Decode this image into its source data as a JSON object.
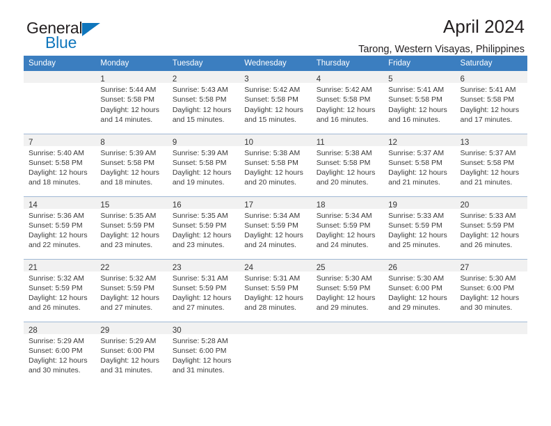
{
  "brand": {
    "name_top": "General",
    "name_bottom": "Blue",
    "accent_color": "#0f76bc",
    "logo_icon": "triangle-icon"
  },
  "header": {
    "title": "April 2024",
    "subtitle": "Tarong, Western Visayas, Philippines"
  },
  "calendar": {
    "header_bg_color": "#3b7ec0",
    "header_text_color": "#ffffff",
    "daynum_band_color": "#f1f1f1",
    "grid_line_color": "#9fb8d4",
    "weekday_headers": [
      "Sunday",
      "Monday",
      "Tuesday",
      "Wednesday",
      "Thursday",
      "Friday",
      "Saturday"
    ],
    "weeks": [
      [
        {
          "day": "",
          "sunrise": "",
          "sunset": "",
          "daylight_line1": "",
          "daylight_line2": ""
        },
        {
          "day": "1",
          "sunrise": "Sunrise: 5:44 AM",
          "sunset": "Sunset: 5:58 PM",
          "daylight_line1": "Daylight: 12 hours",
          "daylight_line2": "and 14 minutes."
        },
        {
          "day": "2",
          "sunrise": "Sunrise: 5:43 AM",
          "sunset": "Sunset: 5:58 PM",
          "daylight_line1": "Daylight: 12 hours",
          "daylight_line2": "and 15 minutes."
        },
        {
          "day": "3",
          "sunrise": "Sunrise: 5:42 AM",
          "sunset": "Sunset: 5:58 PM",
          "daylight_line1": "Daylight: 12 hours",
          "daylight_line2": "and 15 minutes."
        },
        {
          "day": "4",
          "sunrise": "Sunrise: 5:42 AM",
          "sunset": "Sunset: 5:58 PM",
          "daylight_line1": "Daylight: 12 hours",
          "daylight_line2": "and 16 minutes."
        },
        {
          "day": "5",
          "sunrise": "Sunrise: 5:41 AM",
          "sunset": "Sunset: 5:58 PM",
          "daylight_line1": "Daylight: 12 hours",
          "daylight_line2": "and 16 minutes."
        },
        {
          "day": "6",
          "sunrise": "Sunrise: 5:41 AM",
          "sunset": "Sunset: 5:58 PM",
          "daylight_line1": "Daylight: 12 hours",
          "daylight_line2": "and 17 minutes."
        }
      ],
      [
        {
          "day": "7",
          "sunrise": "Sunrise: 5:40 AM",
          "sunset": "Sunset: 5:58 PM",
          "daylight_line1": "Daylight: 12 hours",
          "daylight_line2": "and 18 minutes."
        },
        {
          "day": "8",
          "sunrise": "Sunrise: 5:39 AM",
          "sunset": "Sunset: 5:58 PM",
          "daylight_line1": "Daylight: 12 hours",
          "daylight_line2": "and 18 minutes."
        },
        {
          "day": "9",
          "sunrise": "Sunrise: 5:39 AM",
          "sunset": "Sunset: 5:58 PM",
          "daylight_line1": "Daylight: 12 hours",
          "daylight_line2": "and 19 minutes."
        },
        {
          "day": "10",
          "sunrise": "Sunrise: 5:38 AM",
          "sunset": "Sunset: 5:58 PM",
          "daylight_line1": "Daylight: 12 hours",
          "daylight_line2": "and 20 minutes."
        },
        {
          "day": "11",
          "sunrise": "Sunrise: 5:38 AM",
          "sunset": "Sunset: 5:58 PM",
          "daylight_line1": "Daylight: 12 hours",
          "daylight_line2": "and 20 minutes."
        },
        {
          "day": "12",
          "sunrise": "Sunrise: 5:37 AM",
          "sunset": "Sunset: 5:58 PM",
          "daylight_line1": "Daylight: 12 hours",
          "daylight_line2": "and 21 minutes."
        },
        {
          "day": "13",
          "sunrise": "Sunrise: 5:37 AM",
          "sunset": "Sunset: 5:58 PM",
          "daylight_line1": "Daylight: 12 hours",
          "daylight_line2": "and 21 minutes."
        }
      ],
      [
        {
          "day": "14",
          "sunrise": "Sunrise: 5:36 AM",
          "sunset": "Sunset: 5:59 PM",
          "daylight_line1": "Daylight: 12 hours",
          "daylight_line2": "and 22 minutes."
        },
        {
          "day": "15",
          "sunrise": "Sunrise: 5:35 AM",
          "sunset": "Sunset: 5:59 PM",
          "daylight_line1": "Daylight: 12 hours",
          "daylight_line2": "and 23 minutes."
        },
        {
          "day": "16",
          "sunrise": "Sunrise: 5:35 AM",
          "sunset": "Sunset: 5:59 PM",
          "daylight_line1": "Daylight: 12 hours",
          "daylight_line2": "and 23 minutes."
        },
        {
          "day": "17",
          "sunrise": "Sunrise: 5:34 AM",
          "sunset": "Sunset: 5:59 PM",
          "daylight_line1": "Daylight: 12 hours",
          "daylight_line2": "and 24 minutes."
        },
        {
          "day": "18",
          "sunrise": "Sunrise: 5:34 AM",
          "sunset": "Sunset: 5:59 PM",
          "daylight_line1": "Daylight: 12 hours",
          "daylight_line2": "and 24 minutes."
        },
        {
          "day": "19",
          "sunrise": "Sunrise: 5:33 AM",
          "sunset": "Sunset: 5:59 PM",
          "daylight_line1": "Daylight: 12 hours",
          "daylight_line2": "and 25 minutes."
        },
        {
          "day": "20",
          "sunrise": "Sunrise: 5:33 AM",
          "sunset": "Sunset: 5:59 PM",
          "daylight_line1": "Daylight: 12 hours",
          "daylight_line2": "and 26 minutes."
        }
      ],
      [
        {
          "day": "21",
          "sunrise": "Sunrise: 5:32 AM",
          "sunset": "Sunset: 5:59 PM",
          "daylight_line1": "Daylight: 12 hours",
          "daylight_line2": "and 26 minutes."
        },
        {
          "day": "22",
          "sunrise": "Sunrise: 5:32 AM",
          "sunset": "Sunset: 5:59 PM",
          "daylight_line1": "Daylight: 12 hours",
          "daylight_line2": "and 27 minutes."
        },
        {
          "day": "23",
          "sunrise": "Sunrise: 5:31 AM",
          "sunset": "Sunset: 5:59 PM",
          "daylight_line1": "Daylight: 12 hours",
          "daylight_line2": "and 27 minutes."
        },
        {
          "day": "24",
          "sunrise": "Sunrise: 5:31 AM",
          "sunset": "Sunset: 5:59 PM",
          "daylight_line1": "Daylight: 12 hours",
          "daylight_line2": "and 28 minutes."
        },
        {
          "day": "25",
          "sunrise": "Sunrise: 5:30 AM",
          "sunset": "Sunset: 5:59 PM",
          "daylight_line1": "Daylight: 12 hours",
          "daylight_line2": "and 29 minutes."
        },
        {
          "day": "26",
          "sunrise": "Sunrise: 5:30 AM",
          "sunset": "Sunset: 6:00 PM",
          "daylight_line1": "Daylight: 12 hours",
          "daylight_line2": "and 29 minutes."
        },
        {
          "day": "27",
          "sunrise": "Sunrise: 5:30 AM",
          "sunset": "Sunset: 6:00 PM",
          "daylight_line1": "Daylight: 12 hours",
          "daylight_line2": "and 30 minutes."
        }
      ],
      [
        {
          "day": "28",
          "sunrise": "Sunrise: 5:29 AM",
          "sunset": "Sunset: 6:00 PM",
          "daylight_line1": "Daylight: 12 hours",
          "daylight_line2": "and 30 minutes."
        },
        {
          "day": "29",
          "sunrise": "Sunrise: 5:29 AM",
          "sunset": "Sunset: 6:00 PM",
          "daylight_line1": "Daylight: 12 hours",
          "daylight_line2": "and 31 minutes."
        },
        {
          "day": "30",
          "sunrise": "Sunrise: 5:28 AM",
          "sunset": "Sunset: 6:00 PM",
          "daylight_line1": "Daylight: 12 hours",
          "daylight_line2": "and 31 minutes."
        },
        {
          "day": "",
          "sunrise": "",
          "sunset": "",
          "daylight_line1": "",
          "daylight_line2": ""
        },
        {
          "day": "",
          "sunrise": "",
          "sunset": "",
          "daylight_line1": "",
          "daylight_line2": ""
        },
        {
          "day": "",
          "sunrise": "",
          "sunset": "",
          "daylight_line1": "",
          "daylight_line2": ""
        },
        {
          "day": "",
          "sunrise": "",
          "sunset": "",
          "daylight_line1": "",
          "daylight_line2": ""
        }
      ]
    ]
  }
}
